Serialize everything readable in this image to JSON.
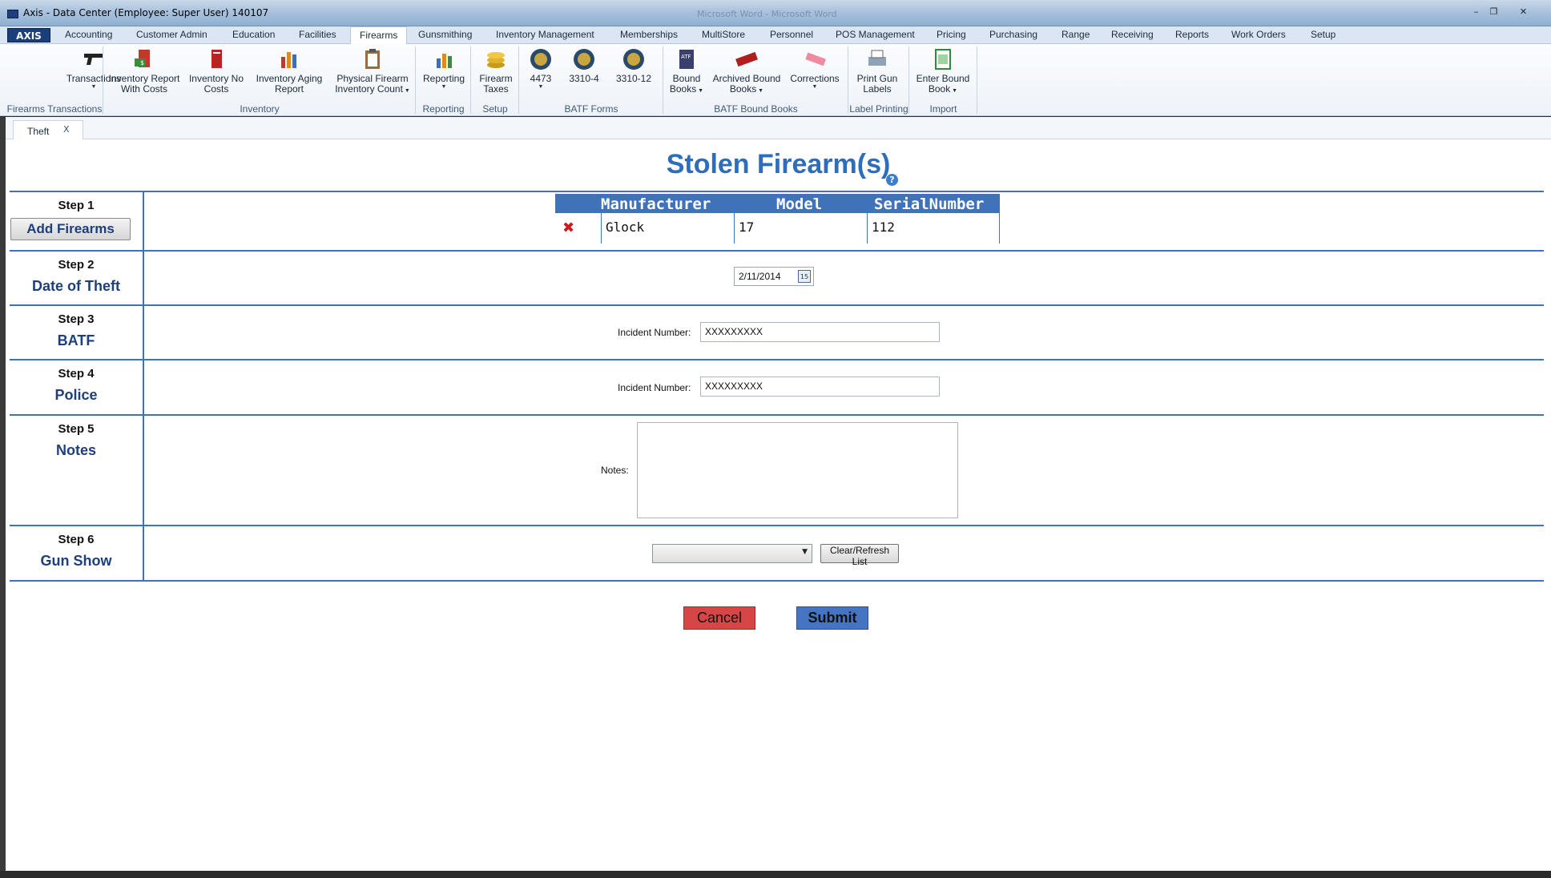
{
  "window": {
    "title": "Axis - Data Center  (Employee: Super User) 140107",
    "ghost_title": "Microsoft Word - Microsoft Word"
  },
  "menu": {
    "logo": "AXIS",
    "items": [
      "Accounting",
      "Customer Admin",
      "Education",
      "Facilities",
      "Firearms",
      "Gunsmithing",
      "Inventory Management",
      "Memberships",
      "MultiStore",
      "Personnel",
      "POS Management",
      "Pricing",
      "Purchasing",
      "Range",
      "Receiving",
      "Reports",
      "Work Orders",
      "Setup"
    ],
    "active": "Firearms"
  },
  "ribbon": {
    "buttons": [
      {
        "l1": "Transactions",
        "l2": "",
        "icon": "pistol-icon",
        "arrow": true
      },
      {
        "l1": "Inventory Report",
        "l2": "With Costs",
        "icon": "report-money-icon"
      },
      {
        "l1": "Inventory No",
        "l2": "Costs",
        "icon": "report-icon"
      },
      {
        "l1": "Inventory Aging",
        "l2": "Report",
        "icon": "aging-chart-icon"
      },
      {
        "l1": "Physical Firearm",
        "l2": "Inventory Count",
        "icon": "clipboard-icon",
        "arrow_inline": true
      },
      {
        "l1": "Reporting",
        "l2": "",
        "icon": "bar-chart-icon",
        "arrow": true
      },
      {
        "l1": "Firearm",
        "l2": "Taxes",
        "icon": "coins-icon"
      },
      {
        "l1": "4473",
        "l2": "",
        "icon": "atf-seal-icon",
        "arrow": true
      },
      {
        "l1": "3310-4",
        "l2": "",
        "icon": "atf-seal-icon"
      },
      {
        "l1": "3310-12",
        "l2": "",
        "icon": "atf-seal-icon"
      },
      {
        "l1": "Bound",
        "l2": "Books",
        "icon": "bound-book-icon",
        "arrow_inline": true
      },
      {
        "l1": "Archived Bound",
        "l2": "Books",
        "icon": "archived-stamp-icon",
        "arrow_inline": true
      },
      {
        "l1": "Corrections",
        "l2": "",
        "icon": "eraser-icon",
        "arrow": true
      },
      {
        "l1": "Print Gun",
        "l2": "Labels",
        "icon": "printer-icon"
      },
      {
        "l1": "Enter Bound",
        "l2": "Book",
        "icon": "spreadsheet-icon",
        "arrow_inline": true
      }
    ],
    "groups": [
      "Firearms Transactions",
      "Inventory",
      "Reporting",
      "Setup",
      "BATF Forms",
      "BATF Bound Books",
      "Label Printing",
      "Import"
    ]
  },
  "tab": {
    "label": "Theft",
    "close": "X"
  },
  "page": {
    "title": "Stolen Firearm(s)",
    "help": "?",
    "steps": [
      {
        "num": "Step 1",
        "label": "Add Firearms"
      },
      {
        "num": "Step 2",
        "label": "Date of Theft"
      },
      {
        "num": "Step 3",
        "label": "BATF"
      },
      {
        "num": "Step 4",
        "label": "Police"
      },
      {
        "num": "Step 5",
        "label": "Notes"
      },
      {
        "num": "Step 6",
        "label": "Gun Show"
      }
    ],
    "grid": {
      "headers": [
        "Manufacturer",
        "Model",
        "SerialNumber"
      ],
      "rows": [
        {
          "manufacturer": "Glock",
          "model": "17",
          "serial": "112"
        }
      ]
    },
    "date_of_theft": "2/11/2014",
    "calendar_glyph": "15",
    "batf": {
      "label": "Incident Number:",
      "value": "XXXXXXXXX"
    },
    "police": {
      "label": "Incident Number:",
      "value": "XXXXXXXXX"
    },
    "notes": {
      "label": "Notes:",
      "value": ""
    },
    "gun_show": {
      "selected": "",
      "refresh_label": "Clear/Refresh List"
    },
    "cancel_label": "Cancel",
    "submit_label": "Submit"
  },
  "colors": {
    "accent": "#3f72b8",
    "title": "#2d6dbb",
    "cancel": "#d64646",
    "submit": "#4574c1"
  }
}
